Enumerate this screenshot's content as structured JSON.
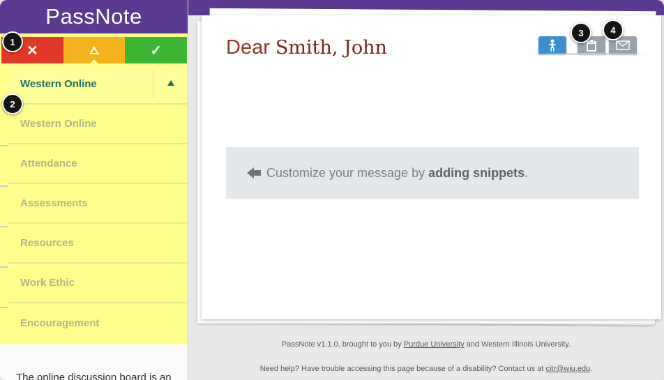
{
  "app": {
    "logo": "PassNote"
  },
  "status_buttons": [
    {
      "label": "✕",
      "color": "#e1382a",
      "meaning": "red"
    },
    {
      "label": "",
      "color": "#f5b21d",
      "meaning": "yellow"
    },
    {
      "label": "✓",
      "color": "#3cb534",
      "meaning": "green"
    }
  ],
  "categories": {
    "selected": "Western Online",
    "items": [
      "Western Online",
      "Attendance",
      "Assessments",
      "Resources",
      "Work Ethic",
      "Encouragement"
    ]
  },
  "preview_text": "The online discussion board is an",
  "letter": {
    "greeting": "Dear",
    "recipient": "Smith, John",
    "hint_prefix": "Customize your message by",
    "hint_bold": "adding snippets",
    "hint_suffix": "."
  },
  "toolbar": {
    "person_icon": "person-icon",
    "clipboard_icon": "clipboard-icon",
    "mail_icon": "mail-icon"
  },
  "footer": {
    "line1_prefix": "PassNote v1.1.0, brought to you by",
    "line1_link": "Purdue University",
    "line1_suffix": "and Western Illinois University.",
    "line2_prefix": "Need help? Have trouble accessing this page because of a disability? Contact us at",
    "line2_link": "citr@wiu.edu",
    "line2_suffix": "."
  },
  "callouts": [
    "1",
    "2",
    "3",
    "4"
  ]
}
